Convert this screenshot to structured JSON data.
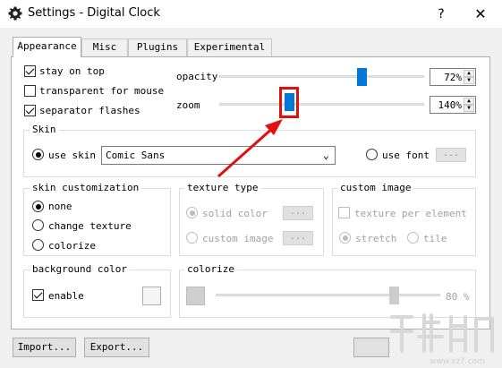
{
  "window": {
    "title": "Settings - Digital Clock",
    "help": "?",
    "close": "✕"
  },
  "tabs": [
    "Appearance",
    "Misc",
    "Plugins",
    "Experimental"
  ],
  "options": {
    "stay_on_top": {
      "label": "stay on top",
      "checked": true
    },
    "transparent_for_mouse": {
      "label": "transparent for mouse",
      "checked": false
    },
    "separator_flashes": {
      "label": "separator flashes",
      "checked": true
    }
  },
  "opacity": {
    "label": "opacity",
    "value": "72%",
    "level": 0.72
  },
  "zoom": {
    "label": "zoom",
    "value": "140%"
  },
  "skin": {
    "title": "Skin",
    "use_skin_label": "use skin",
    "selected_skin": "Comic Sans",
    "use_font_label": "use font",
    "font_button": "..."
  },
  "skin_customization": {
    "title": "skin customization",
    "none": "none",
    "change_texture": "change texture",
    "colorize": "colorize"
  },
  "texture_type": {
    "title": "texture type",
    "solid_color": "solid color",
    "custom_image": "custom image",
    "btn1": "...",
    "btn2": "..."
  },
  "custom_image": {
    "title": "custom image",
    "texture_per_element": "texture per element",
    "stretch": "stretch",
    "tile": "tile"
  },
  "background_color": {
    "title": "background color",
    "enable": "enable"
  },
  "colorize": {
    "title": "colorize",
    "value": "80 %",
    "level": 0.8
  },
  "buttons": {
    "import": "Import...",
    "export": "Export..."
  },
  "colors": {
    "accent": "#0078d7",
    "annotation": "#e01010"
  }
}
